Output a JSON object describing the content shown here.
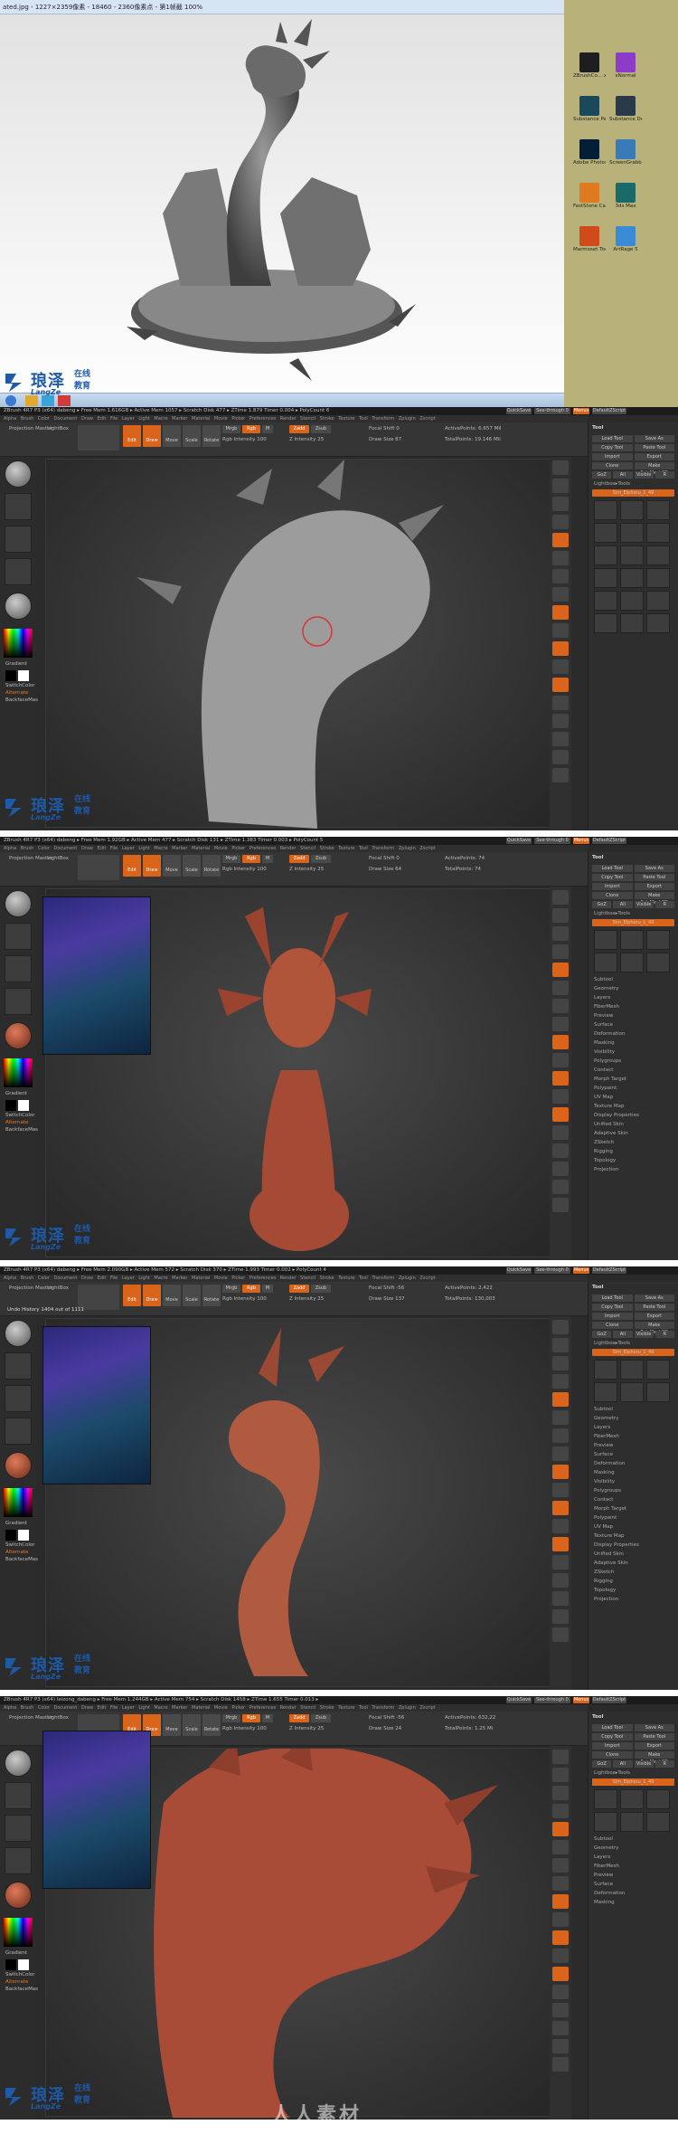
{
  "viewer": {
    "title": "ated.jpg - 1227×2359像素 - 18460 - 2360像素点 - 第1帧截 100%",
    "buttons": [
      "_",
      "□",
      "✕"
    ]
  },
  "desktop": {
    "icons": [
      {
        "label": "ZBrushCo... x64",
        "color": "#1e1e1e"
      },
      {
        "label": "xNormal",
        "color": "#8c3cc8"
      },
      {
        "label": "Substance Painter",
        "color": "#1a4a5a"
      },
      {
        "label": "Substance Designer",
        "color": "#2a3a4a"
      },
      {
        "label": "Adobe Photosho...",
        "color": "#001e36"
      },
      {
        "label": "ScreenGrabber",
        "color": "#3a7ab8"
      },
      {
        "label": "FastStone Capture",
        "color": "#e07a20"
      },
      {
        "label": "3ds Max",
        "color": "#1a6a6a"
      },
      {
        "label": "Marmoset Toolbag",
        "color": "#d04a1a"
      },
      {
        "label": "ArtRage 5",
        "color": "#3a8ad8"
      }
    ]
  },
  "watermark": {
    "cn": "琅泽",
    "online": "在线",
    "edu": "教育",
    "en": "LangZe"
  },
  "sitewm": "人人素材",
  "zbrush": {
    "panels": [
      {
        "title": "ZBrush 4R7 P3 (x64)   dabeng   ▸ Free Mem 1.616GB ▸ Active Mem 1057 ▸ Scratch Disk 477 ▸ ZTime 1.879 Timer 0.004 ▸ PolyCount 6",
        "menus": "Alpha Brush Color Document Draw Edit File Layer Light Macro Marker Material Movie Picker Preferences Render Stencil Stroke Texture Tool Transform Zplugin Zscript",
        "active_points": "ActivePoints: 6.657 Mil",
        "total_points": "TotalPoints: 19.146 Mil",
        "focal": "Focal Shift 0",
        "draw": "Draw Size 87",
        "quicksave": "QuickSave",
        "seethrough": "See-through 0",
        "menus_btn": "Menus",
        "script": "DefaultZScript",
        "zadd": "Zadd",
        "rgb_int": "Rgb Intensity 100",
        "z_int": "Z Intensity 25"
      },
      {
        "title": "ZBrush 4R7 P3 (x64)   dabeng   ▸ Free Mem 1.92GB ▸ Active Mem 477 ▸ Scratch Disk 131 ▸ ZTime 1.383 Timer 0.003 ▸ PolyCount 5",
        "menus": "Alpha Brush Color Document Draw Edit File Layer Light Macro Marker Material Movie Picker Preferences Render Stencil Stroke Texture Tool Transform Zplugin Zscript",
        "active_points": "ActivePoints: 74",
        "total_points": "TotalPoints: 74",
        "focal": "Focal Shift 0",
        "draw": "Draw Size 64",
        "quicksave": "QuickSave",
        "seethrough": "See-through 0",
        "menus_btn": "Menus",
        "script": "DefaultZScript",
        "zadd": "Zadd",
        "rgb_int": "Rgb Intensity 100",
        "z_int": "Z Intensity 25"
      },
      {
        "title": "ZBrush 4R7 P3 (x64)   dabeng   ▸ Free Mem 2.090GB ▸ Active Mem 572 ▸ Scratch Disk 370 ▸ ZTime 1.993 Timer 0.002 ▸ PolyCount 4",
        "menus": "Alpha Brush Color Document Draw Edit File Layer Light Macro Marker Material Movie Picker Preferences Render Stencil Stroke Texture Tool Transform Zplugin Zscript",
        "active_points": "ActivePoints: 2,422",
        "total_points": "TotalPoints: 130,003",
        "focal": "Focal Shift -56",
        "draw": "Draw Size 137",
        "quicksave": "QuickSave",
        "seethrough": "See-through 0",
        "menus_btn": "Menus",
        "script": "DefaultZScript",
        "zadd": "Zadd",
        "rgb_int": "Rgb Intensity 100",
        "z_int": "Z Intensity 25",
        "note": "Undo History 1404 out of 1111"
      },
      {
        "title": "ZBrush 4R7 P3 (x64)   leizong_dabeng   ▸ Free Mem 1.244GB ▸ Active Mem 754 ▸ Scratch Disk 1458 ▸ ZTime 1.655 Timer 0.013 ▸",
        "menus": "Alpha Brush Color Document Draw Edit File Layer Light Macro Marker Material Movie Picker Preferences Render Stencil Stroke Texture Tool Transform Zplugin Zscript",
        "active_points": "ActivePoints: 632,22",
        "total_points": "TotalPoints: 1.25 Mi",
        "focal": "Focal Shift -56",
        "draw": "Draw Size 24",
        "quicksave": "QuickSave",
        "seethrough": "See-through 0",
        "menus_btn": "Menus",
        "script": "DefaultZScript",
        "zadd": "Zadd",
        "rgb_int": "Rgb Intensity 100",
        "z_int": "Z Intensity 25"
      }
    ],
    "left": {
      "projection": "Projection Master",
      "lightbox": "LightBox",
      "gradient": "Gradient",
      "switchcolor": "SwitchColor",
      "alternate": "Alternate",
      "backface": "BackfaceMas"
    },
    "tool": {
      "title": "Tool",
      "load": "Load Tool",
      "save": "Save As",
      "copy": "Copy Tool",
      "paste": "Paste Tool",
      "import": "Import",
      "export": "Export",
      "clone": "Clone",
      "polymesh": "Make PolyMesh3D",
      "goz": "GoZ",
      "all": "All",
      "visible": "Visible",
      "r": "R",
      "lightbox_tools": "Lightbox▸Tools",
      "current": "Sim_Elphoru_1_49",
      "sub": [
        "Subtool",
        "Geometry",
        "Layers",
        "FiberMesh",
        "Preview",
        "Surface",
        "Deformation",
        "Masking",
        "Visibility",
        "Polygroups",
        "Contact",
        "Morph Target",
        "Polypaint",
        "UV Map",
        "Texture Map",
        "Display Properties",
        "Unified Skin",
        "Adaptive Skin",
        "ZSketch",
        "Rigging",
        "Topology",
        "Projection"
      ]
    },
    "shelf": [
      "Edit",
      "Draw",
      "Move",
      "Scale",
      "Rotate"
    ],
    "mrgb": [
      "Mrgb",
      "Rgb",
      "M"
    ],
    "zsub": "Zsub",
    "zcut": "Zcut"
  }
}
